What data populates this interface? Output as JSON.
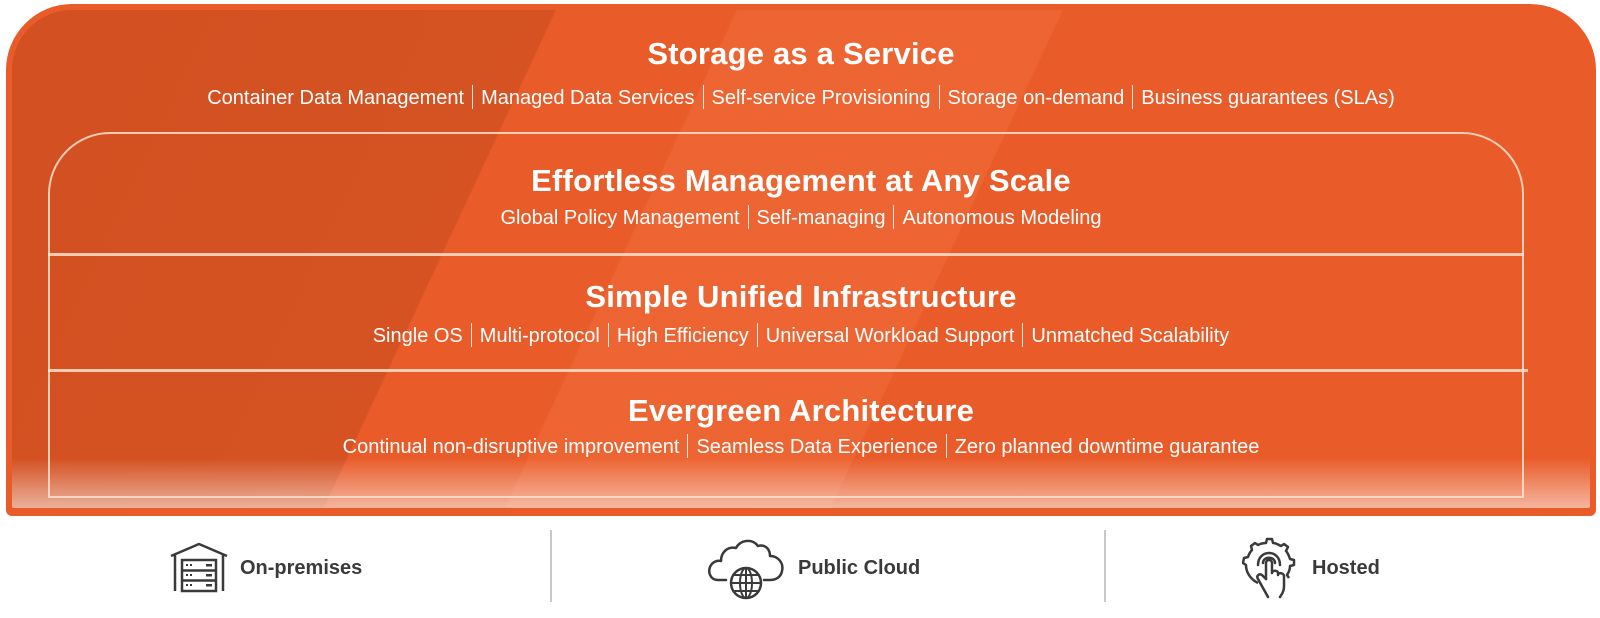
{
  "colors": {
    "brand_orange": "#e95c2a",
    "text_light": "#ffffff",
    "platform_text": "#3a3a3a"
  },
  "layers": [
    {
      "title": "Storage as a Service",
      "items": [
        "Container Data Management",
        "Managed Data Services",
        "Self-service Provisioning",
        "Storage on-demand",
        "Business guarantees (SLAs)"
      ]
    },
    {
      "title": "Effortless Management at Any Scale",
      "items": [
        "Global Policy Management",
        "Self-managing",
        "Autonomous Modeling"
      ]
    },
    {
      "title": "Simple Unified Infrastructure",
      "items": [
        "Single OS",
        "Multi-protocol",
        "High Efficiency",
        "Universal Workload Support",
        "Unmatched Scalability"
      ]
    },
    {
      "title": "Evergreen Architecture",
      "items": [
        "Continual non-disruptive improvement",
        "Seamless Data Experience",
        "Zero planned downtime guarantee"
      ]
    }
  ],
  "platforms": [
    {
      "label": "On-premises",
      "icon": "house-server-icon"
    },
    {
      "label": "Public Cloud",
      "icon": "cloud-globe-icon"
    },
    {
      "label": "Hosted",
      "icon": "gear-hand-icon"
    }
  ]
}
